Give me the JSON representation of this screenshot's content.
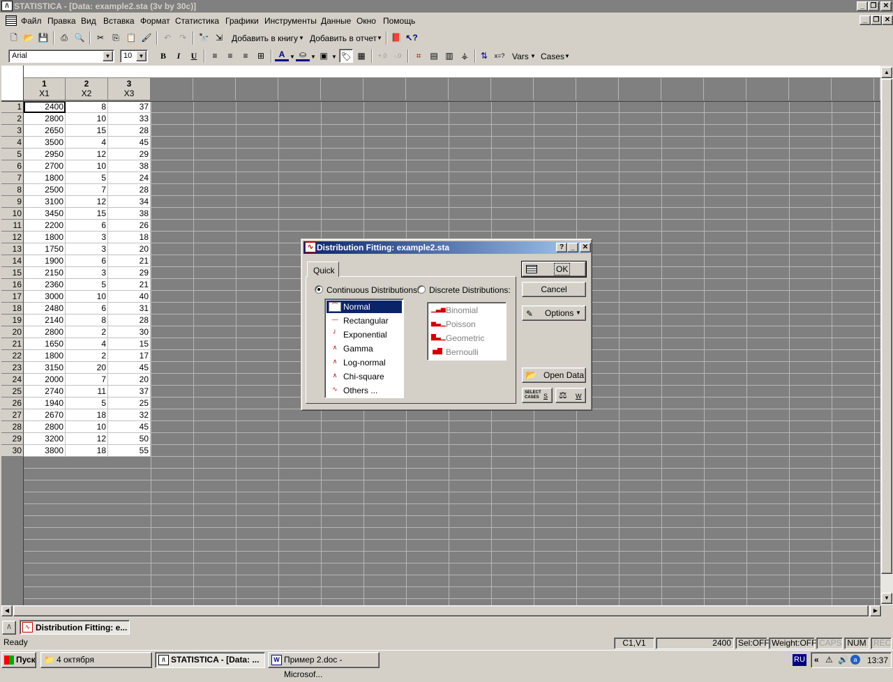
{
  "window": {
    "title": "STATISTICA - [Data: example2.sta (3v by 30c)]"
  },
  "menu": [
    "Файл",
    "Правка",
    "Вид",
    "Вставка",
    "Формат",
    "Статистика",
    "Графики",
    "Инструменты",
    "Данные",
    "Окно",
    "Помощь"
  ],
  "toolbar": {
    "add_to_book": "Добавить в книгу",
    "add_to_report": "Добавить в отчет",
    "font_name": "Arial",
    "font_size": "10",
    "bold": "B",
    "italic": "I",
    "underline": "U",
    "vars": "Vars",
    "cases": "Cases"
  },
  "sheet": {
    "columns": [
      {
        "num": "1",
        "name": "X1"
      },
      {
        "num": "2",
        "name": "X2"
      },
      {
        "num": "3",
        "name": "X3"
      }
    ],
    "rows": [
      [
        "2400",
        "8",
        "37"
      ],
      [
        "2800",
        "10",
        "33"
      ],
      [
        "2650",
        "15",
        "28"
      ],
      [
        "3500",
        "4",
        "45"
      ],
      [
        "2950",
        "12",
        "29"
      ],
      [
        "2700",
        "10",
        "38"
      ],
      [
        "1800",
        "5",
        "24"
      ],
      [
        "2500",
        "7",
        "28"
      ],
      [
        "3100",
        "12",
        "34"
      ],
      [
        "3450",
        "15",
        "38"
      ],
      [
        "2200",
        "6",
        "26"
      ],
      [
        "1800",
        "3",
        "18"
      ],
      [
        "1750",
        "3",
        "20"
      ],
      [
        "1900",
        "6",
        "21"
      ],
      [
        "2150",
        "3",
        "29"
      ],
      [
        "2360",
        "5",
        "21"
      ],
      [
        "3000",
        "10",
        "40"
      ],
      [
        "2480",
        "6",
        "31"
      ],
      [
        "2140",
        "8",
        "28"
      ],
      [
        "2800",
        "2",
        "30"
      ],
      [
        "1650",
        "4",
        "15"
      ],
      [
        "1800",
        "2",
        "17"
      ],
      [
        "3150",
        "20",
        "45"
      ],
      [
        "2000",
        "7",
        "20"
      ],
      [
        "2740",
        "11",
        "37"
      ],
      [
        "1940",
        "5",
        "25"
      ],
      [
        "2670",
        "18",
        "32"
      ],
      [
        "2800",
        "10",
        "45"
      ],
      [
        "3200",
        "12",
        "50"
      ],
      [
        "3800",
        "18",
        "55"
      ]
    ]
  },
  "dialog": {
    "title": "Distribution Fitting: example2.sta",
    "tab": "Quick",
    "continuous_label": "Continuous Distributions:",
    "discrete_label": "Discrete Distributions:",
    "continuous": [
      "Normal",
      "Rectangular",
      "Exponential",
      "Gamma",
      "Log-normal",
      "Chi-square",
      "Others ..."
    ],
    "discrete": [
      "Binomial",
      "Poisson",
      "Geometric",
      "Bernoulli"
    ],
    "ok": "OK",
    "cancel": "Cancel",
    "options": "Options",
    "open_data": "Open Data",
    "select_cases": "SELECT CASES",
    "s": "S",
    "w": "W"
  },
  "mdi_tab": "Distribution Fitting: e...",
  "status": {
    "ready": "Ready",
    "cell": "C1,V1",
    "value": "2400",
    "sel": "Sel:OFF",
    "weight": "Weight:OFF",
    "caps": "CAPS",
    "num": "NUM",
    "rec": "REC"
  },
  "taskbar": {
    "start": "Пуск",
    "items": [
      "4 октября",
      "STATISTICA - [Data: ...",
      "Пример 2.doc - Microsof..."
    ],
    "lang": "RU",
    "time": "13:37"
  }
}
